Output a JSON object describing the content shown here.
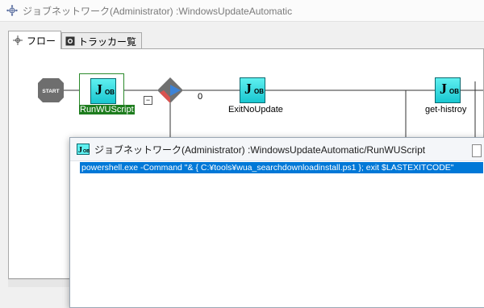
{
  "window": {
    "title": "ジョブネットワーク(Administrator) :WindowsUpdateAutomatic"
  },
  "tabs": [
    {
      "label": "フロー",
      "icon": "flow-icon",
      "active": true
    },
    {
      "label": "トラッカー覧",
      "icon": "tracker-icon",
      "active": false
    }
  ],
  "flow": {
    "start_label": "START",
    "job_icon_text": "J",
    "job_icon_sub": "OB",
    "nodes": [
      {
        "label": "RunWUScript",
        "selected": true
      },
      {
        "label": "ExitNoUpdate",
        "selected": false
      },
      {
        "label": "get-histroy",
        "selected": false
      }
    ],
    "branch_value": "0",
    "collapse_symbol": "−"
  },
  "subwindow": {
    "title": "ジョブネットワーク(Administrator) :WindowsUpdateAutomatic/RunWUScript",
    "command": "powershell.exe -Command \"& { C:¥tools¥wua_searchdownloadinstall.ps1 }; exit $LASTEXITCODE\""
  }
}
